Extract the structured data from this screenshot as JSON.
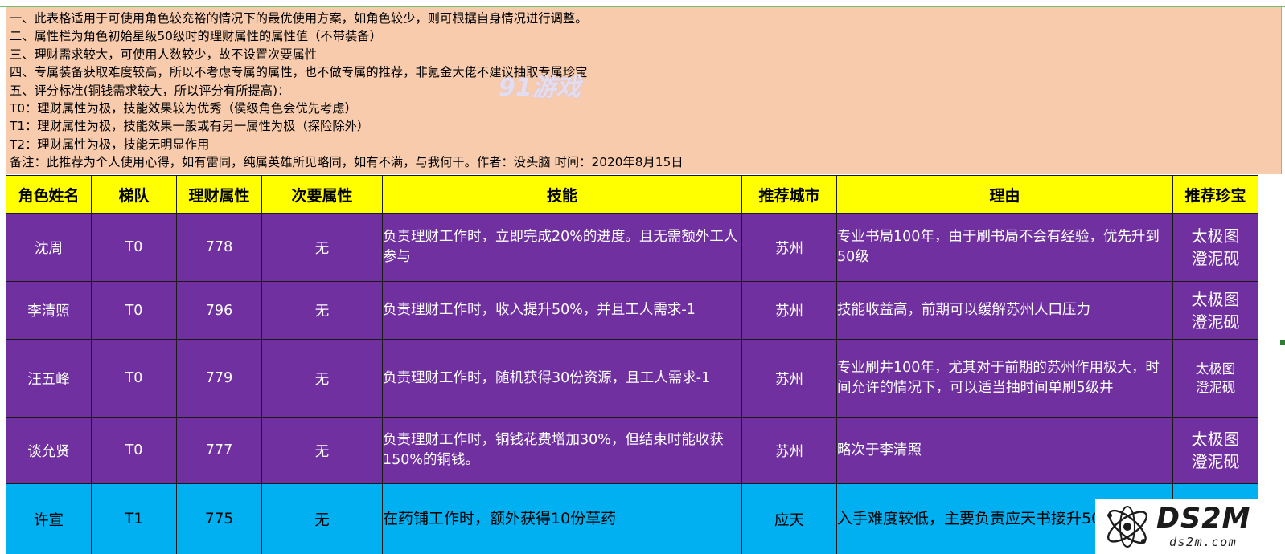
{
  "notes": [
    "一、此表格适用于可使用角色较充裕的情况下的最优使用方案，如角色较少，则可根据自身情况进行调整。",
    "二、属性栏为角色初始星级50级时的理财属性的属性值（不带装备）",
    "三、理财需求较大，可使用人数较少，故不设置次要属性",
    "四、专属装备获取难度较高，所以不考虑专属的属性，也不做专属的推荐，非氪金大佬不建议抽取专属珍宝",
    "五、评分标准(铜钱需求较大，所以评分有所提高)：",
    "T0：理财属性为极，技能效果较为优秀（侯级角色会优先考虑）",
    "T1：理财属性为极，技能效果一般或有另一属性为极（探险除外）",
    "T2：理财属性为极，技能无明显作用",
    "备注：此推荐为个人使用心得，如有雷同，纯属英雄所见略同，如有不满，与我何干。作者：没头脑  时间：2020年8月15日"
  ],
  "watermark": "91游戏",
  "table": {
    "headers": [
      "角色姓名",
      "梯队",
      "理财属性",
      "次要属性",
      "技能",
      "推荐城市",
      "理由",
      "推荐珍宝"
    ],
    "rows": [
      {
        "name": "沈周",
        "tier": "T0",
        "finance": "778",
        "secondary": "无",
        "skill": "负责理财工作时，立即完成20%的进度。且无需额外工人参与",
        "city": "苏州",
        "reason": "专业书局100年，由于刷书局不会有经验，优先升到50级",
        "treasure": [
          "太极图",
          "澄泥砚"
        ]
      },
      {
        "name": "李清照",
        "tier": "T0",
        "finance": "796",
        "secondary": "无",
        "skill": "负责理财工作时，收入提升50%，并且工人需求-1",
        "city": "苏州",
        "reason": "技能收益高，前期可以缓解苏州人口压力",
        "treasure": [
          "太极图",
          "澄泥砚"
        ]
      },
      {
        "name": "汪五峰",
        "tier": "T0",
        "finance": "779",
        "secondary": "无",
        "skill": "负责理财工作时，随机获得30份资源，且工人需求-1",
        "city": "苏州",
        "reason": "专业刷井100年，尤其对于前期的苏州作用极大，时间允许的情况下，可以适当抽时间单刷5级井",
        "treasure": [
          "太极图",
          "澄泥砚"
        ]
      },
      {
        "name": "谈允贤",
        "tier": "T0",
        "finance": "777",
        "secondary": "无",
        "skill": "负责理财工作时，铜钱花费增加30%，但结束时能收获150%的铜钱。",
        "city": "苏州",
        "reason": "略次于李清照",
        "treasure": [
          "太极图",
          "澄泥砚"
        ]
      },
      {
        "name": "许宣",
        "tier": "T1",
        "finance": "775",
        "secondary": "无",
        "skill": "在药铺工作时，额外获得10份草药",
        "city": "应天",
        "reason": "入手难度较低，主要负责应天书接升50级",
        "treasure": []
      }
    ]
  },
  "logo": {
    "main": "DS2M",
    "sub": "ds2m.com"
  },
  "colors": {
    "notes_bg": "#f8cbad",
    "header_bg": "#ffff00",
    "tier0_bg": "#7030a0",
    "tier1_bg": "#00b0f0"
  }
}
